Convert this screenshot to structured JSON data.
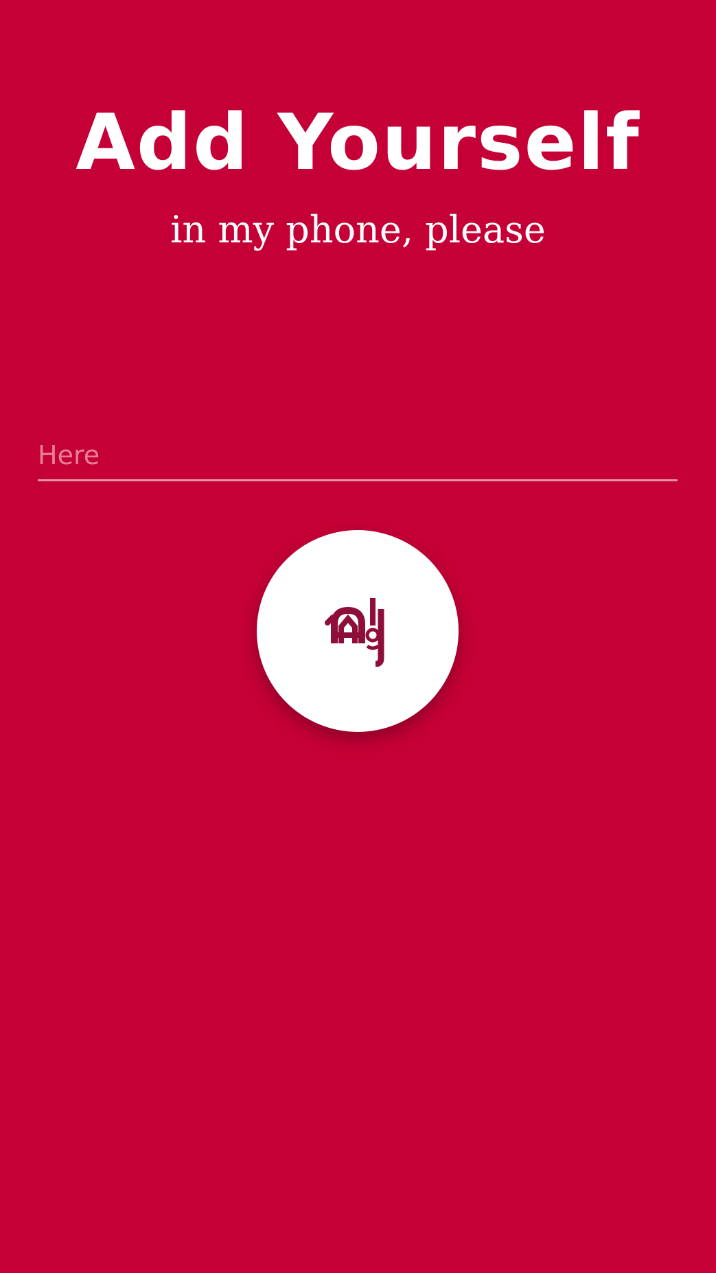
{
  "header": {
    "title": "Add Yourself",
    "subtitle": "in my phone, please"
  },
  "form": {
    "input_value": "",
    "input_placeholder": "Here"
  },
  "submit_button": {
    "icon": "app-logo-icon"
  },
  "colors": {
    "background": "#c40036",
    "accent": "#8e0e3a",
    "text": "#ffffff",
    "placeholder": "#e87f97"
  }
}
